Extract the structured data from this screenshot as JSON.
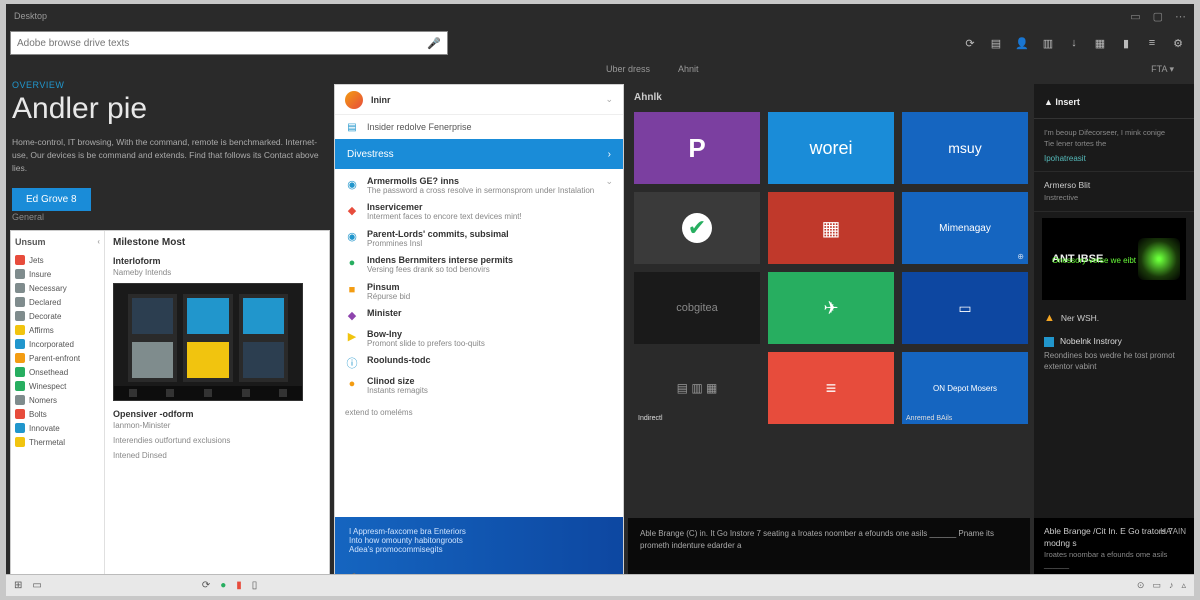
{
  "top": {
    "app_label": "Desktop"
  },
  "search": {
    "placeholder": "Adobe browse drive texts"
  },
  "tabs": {
    "a": "Uber dress",
    "b": "Ahnit",
    "extra": "FTA  ▾"
  },
  "hero": {
    "eyebrow": "OVERVIEW",
    "title": "Andler pie",
    "desc": "Home-control, IT browsing, With the command, remote is benchmarked. Internet-use, Our devices is be command and extends. Find that follows its Contact above lies.",
    "cta": "Ed Grove 8"
  },
  "left_title": "General",
  "lp": {
    "head": "Unsum",
    "items": [
      {
        "color": "#e74c3c",
        "label": "Jets"
      },
      {
        "color": "#7f8c8d",
        "label": "Insure"
      },
      {
        "color": "#7f8c8d",
        "label": "Necessary"
      },
      {
        "color": "#7f8c8d",
        "label": "Declared"
      },
      {
        "color": "#7f8c8d",
        "label": "Decorate"
      },
      {
        "color": "#f1c40f",
        "label": "Affirms"
      },
      {
        "color": "#2196cc",
        "label": "Incorporated"
      },
      {
        "color": "#f39c12",
        "label": "Parent-enfront"
      },
      {
        "color": "#27ae60",
        "label": "Onsethead"
      },
      {
        "color": "#27ae60",
        "label": "Winespect"
      },
      {
        "color": "#7f8c8d",
        "label": "Nomers"
      },
      {
        "color": "#e74c3c",
        "label": "Bolts"
      },
      {
        "color": "#2196cc",
        "label": "Innovate"
      },
      {
        "color": "#f1c40f",
        "label": "Thermetal"
      }
    ],
    "content_title": "Milestone Most",
    "sub1": "Interloform",
    "desc1": "Nameby Intends",
    "sub2": "Opensiver -odform",
    "desc2": "Ianmon-Minister",
    "desc3": "Interendies outfortund exclusions",
    "desc4": "Intened Dinsed"
  },
  "mid": {
    "head": "Ininr",
    "row1": "Insider redolve Fenerprise",
    "promo": "Divestress",
    "items": [
      {
        "ico": "◉",
        "col": "#2196cc",
        "title": "Armermolls GE? inns",
        "sub": "The password a cross resolve in sermonsprom under Instalation"
      },
      {
        "ico": "◆",
        "col": "#e74c3c",
        "title": "Inservicemer",
        "sub": "Interment faces to encore text devices mint!"
      },
      {
        "ico": "◉",
        "col": "#2196cc",
        "title": "Parent-Lords' commits, subsimal",
        "sub": "Prommines Insl"
      },
      {
        "ico": "●",
        "col": "#27ae60",
        "title": "Indens Bernmiters interse permits",
        "sub": "Versing fees drank so tod benovirs"
      },
      {
        "ico": "■",
        "col": "#f39c12",
        "title": "Pinsum",
        "sub": "Répurse bid"
      },
      {
        "ico": "◆",
        "col": "#8e44ad",
        "title": "Minister",
        "sub": ""
      },
      {
        "ico": "▶",
        "col": "#f1c40f",
        "title": "Bow-Iny",
        "sub": "Promont slide to prefers too-quits"
      },
      {
        "ico": "ⓘ",
        "col": "#2196cc",
        "title": "Roolunds-todc",
        "sub": ""
      },
      {
        "ico": "●",
        "col": "#f39c12",
        "title": "Clinod size",
        "sub": "Instants remagits"
      }
    ],
    "footer_line": "extend to omeléms",
    "footer1": "I Appresm-faxcome bra Enteriors",
    "footer2": "Into how omounty habitongroots",
    "footer3": "Adea's promocommisegits"
  },
  "tilehead": "Ahnlk",
  "tiles": [
    {
      "bg": "#7b3fa0",
      "label": "P",
      "style": "font-size:26px;font-weight:600"
    },
    {
      "bg": "#1a8cd8",
      "label": "worei",
      "style": "font-size:18px"
    },
    {
      "bg": "#1565c0",
      "label": "msuy",
      "style": "font-size:14px"
    },
    {
      "bg": "#3a3a3a",
      "label": "✔",
      "style": "font-size:22px;color:#27ae60;background:#fff;border-radius:50%;width:30px;height:30px;display:flex;align-items:center;justify-content:center"
    },
    {
      "bg": "#c0392b",
      "label": "▦",
      "style": "font-size:20px"
    },
    {
      "bg": "#1565c0",
      "label": "Mimenagay",
      "style": "font-size:10px",
      "corner": "⊕"
    },
    {
      "bg": "#1a1a1a",
      "label": "cobgitea",
      "style": "font-size:11px;color:#888"
    },
    {
      "bg": "#27ae60",
      "label": "✈",
      "style": "font-size:18px"
    },
    {
      "bg": "#0d47a1",
      "label": "▭",
      "style": "font-size:14px",
      "img": true
    },
    {
      "bg": "#2a2a2a",
      "label": "▤ ▥ ▦",
      "style": "font-size:12px;color:#999",
      "cap": "Indirectl"
    },
    {
      "bg": "#e74c3c",
      "label": "≡",
      "style": "font-size:18px"
    },
    {
      "bg": "#1565c0",
      "label": "ON Depot Mosers",
      "style": "font-size:8px",
      "cap": "Anremed BAils"
    }
  ],
  "tile_footer": "Able Brange (C) in. It Go Instore 7 seating a Iroates noomber a efounds one asils ______ Pname its prometh indenture edarder a",
  "rc": {
    "head": "Insert",
    "b1a": "I'm beoup Difecorseer, I mink conige",
    "b1b": "Tie lener tortes the",
    "b1link": "Ipohatreasit",
    "cat1": "Armerso Blit",
    "cat1s": "Instrective",
    "thumb_title": "ANT IBSE",
    "thumb_sub": "Onessory-verse we eibt",
    "warn": "Ner WSH.",
    "item_h": "Nobelnk Instrory",
    "item_s": "Reondines bos wedre he tost promot extentor vabint",
    "foot_big": "Able Brange /Cit In. E Go trators 7 modng s",
    "foot_s": "Iroates noombar a efounds ome asils ______",
    "foot_tag": "HA AIN"
  }
}
